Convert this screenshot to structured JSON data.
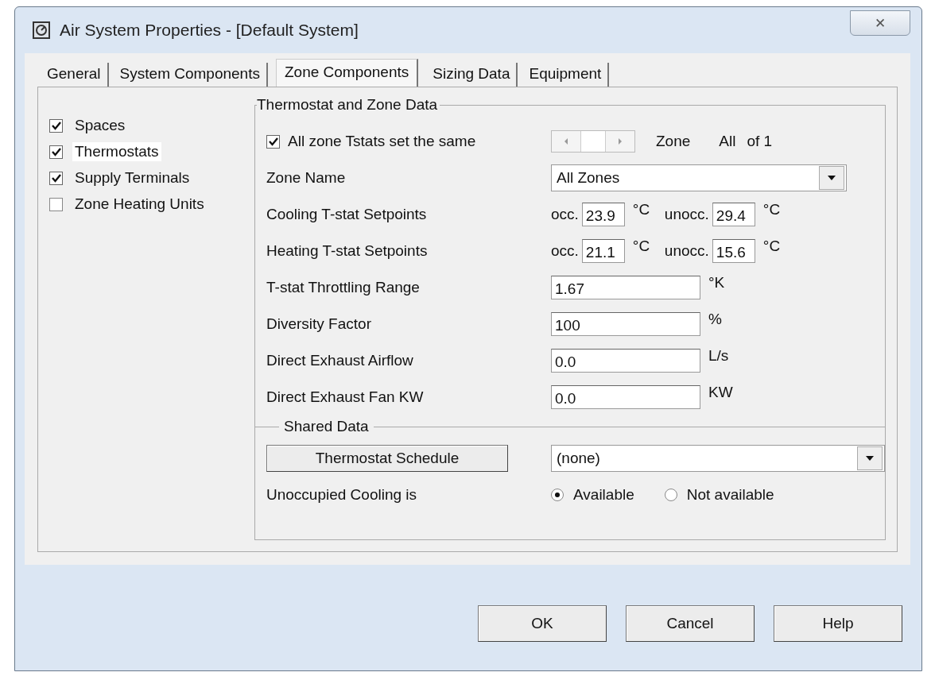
{
  "window": {
    "title": "Air System Properties - [Default System]",
    "close": "✕"
  },
  "tabs": [
    {
      "label": "General",
      "selected": false
    },
    {
      "label": "System Components",
      "selected": false
    },
    {
      "label": "Zone Components",
      "selected": true
    },
    {
      "label": "Sizing Data",
      "selected": false
    },
    {
      "label": "Equipment",
      "selected": false
    }
  ],
  "components": [
    {
      "label": "Spaces",
      "checked": true,
      "focused": false
    },
    {
      "label": "Thermostats",
      "checked": true,
      "focused": true
    },
    {
      "label": "Supply Terminals",
      "checked": true,
      "focused": false
    },
    {
      "label": "Zone Heating Units",
      "checked": false,
      "focused": false
    }
  ],
  "zone_data": {
    "title": "Thermostat and Zone Data",
    "same": {
      "label": "All zone Tstats set the same",
      "checked": true
    },
    "zone_label": "Zone",
    "zone_value": "All",
    "zone_count": "of 1",
    "zone_name": {
      "label": "Zone Name",
      "value": "All Zones"
    },
    "setpoints": [
      {
        "label": "Cooling T-stat Setpoints",
        "occ_label": "occ.",
        "occ_value": "23.9",
        "occ_unit": "°C",
        "unocc_label": "unocc.",
        "unocc_value": "29.4",
        "unocc_unit": "°C"
      },
      {
        "label": "Heating T-stat Setpoints",
        "occ_label": "occ.",
        "occ_value": "21.1",
        "occ_unit": "°C",
        "unocc_label": "unocc.",
        "unocc_value": "15.6",
        "unocc_unit": "°C"
      }
    ],
    "fields": [
      {
        "label": "T-stat Throttling Range",
        "value": "1.67",
        "unit": "°K"
      },
      {
        "label": "Diversity Factor",
        "value": "100",
        "unit": "%"
      },
      {
        "label": "Direct Exhaust Airflow",
        "value": "0.0",
        "unit": "L/s"
      },
      {
        "label": "Direct Exhaust Fan KW",
        "value": "0.0",
        "unit": "KW"
      }
    ]
  },
  "shared": {
    "title": "Shared Data",
    "schedule_button": "Thermostat Schedule",
    "schedule_value": "(none)",
    "cooling_label": "Unoccupied Cooling is",
    "options": [
      {
        "label": "Available",
        "selected": true
      },
      {
        "label": "Not available",
        "selected": false
      }
    ]
  },
  "buttons": [
    "OK",
    "Cancel",
    "Help"
  ]
}
